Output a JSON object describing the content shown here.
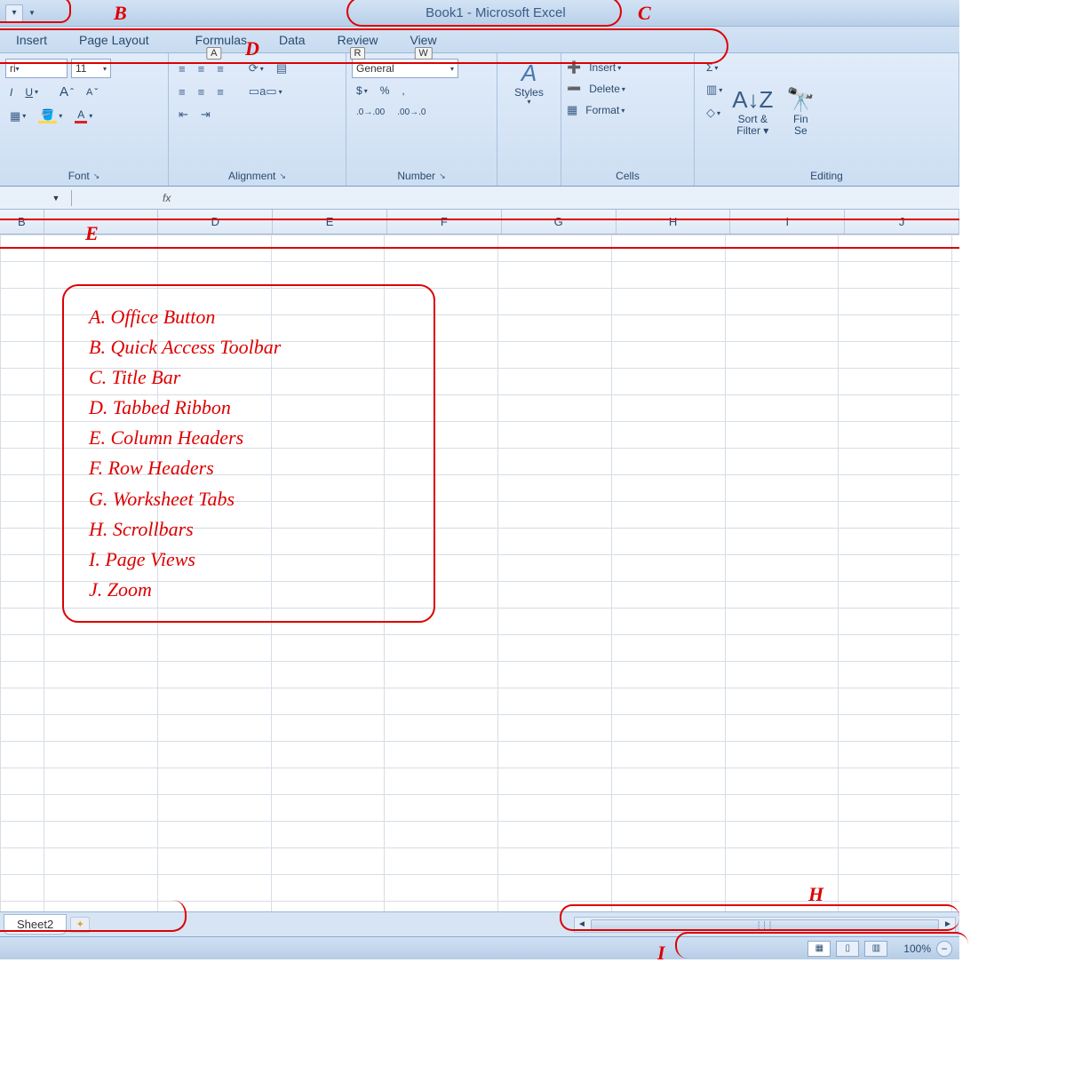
{
  "title": "Book1 - Microsoft Excel",
  "tabs": [
    "Insert",
    "Page Layout",
    "Formulas",
    "Data",
    "Review",
    "View"
  ],
  "key_tips": {
    "formulas": "A",
    "review": "R",
    "view": "W"
  },
  "font": {
    "name": "ri",
    "size": "11"
  },
  "font_group": {
    "bold": "I",
    "underline": "U",
    "grow": "A",
    "shrink": "A",
    "fill": "◊",
    "color": "A",
    "title": "Font"
  },
  "alignment": {
    "title": "Alignment",
    "wrap": "a"
  },
  "number": {
    "format": "General",
    "currency": "$",
    "percent": "%",
    "comma": ",",
    "inc": ".0 .00",
    "dec": ".00",
    "title": "Number"
  },
  "styles": {
    "title": "Styles",
    "icon": "A"
  },
  "cells": {
    "insert": "Insert",
    "delete": "Delete",
    "format": "Format",
    "title": "Cells"
  },
  "editing": {
    "sum": "Σ",
    "fill": "▥",
    "clear": "◇",
    "sort": "Sort & Filter",
    "find": "Find & Select",
    "sort_short": "Sort &",
    "filter_short": "Filter ▾",
    "find_short1": "Fin",
    "find_short2": "Se",
    "title": "Editing"
  },
  "formula_bar": {
    "fx": "fx"
  },
  "columns": [
    "B",
    "",
    "D",
    "E",
    "F",
    "G",
    "H",
    "I",
    "J"
  ],
  "sheets": {
    "active": "Sheet2"
  },
  "zoom": "100%",
  "annotation_labels": {
    "B": "B",
    "C": "C",
    "D": "D",
    "E": "E",
    "H": "H",
    "I": "I"
  },
  "legend": [
    "A.  Office Button",
    "B.  Quick Access Toolbar",
    "C.  Title Bar",
    "D.  Tabbed Ribbon",
    "E.  Column Headers",
    "F.  Row Headers",
    "G.  Worksheet Tabs",
    "H. Scrollbars",
    "I.  Page Views",
    "J.  Zoom"
  ]
}
